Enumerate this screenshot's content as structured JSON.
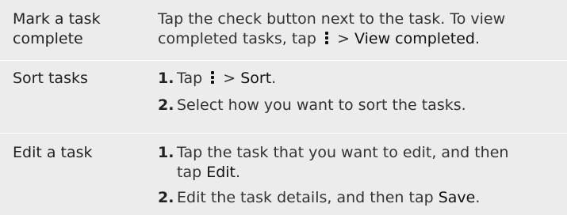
{
  "rows": [
    {
      "label": "Mark a task complete",
      "body_1": "Tap the check button next to the task. To view",
      "body_2a": "completed tasks, tap",
      "body_2b": " > ",
      "body_2c": "View completed",
      "body_2d": "."
    },
    {
      "label": "Sort tasks",
      "steps": [
        {
          "num": "1.",
          "a": "Tap",
          "b": " > ",
          "c": "Sort",
          "d": "."
        },
        {
          "num": "2.",
          "text": "Select how you want to sort the tasks."
        }
      ]
    },
    {
      "label": "Edit a task",
      "steps": [
        {
          "num": "1.",
          "line1": "Tap the task that you want to edit, and then",
          "line2a": "tap ",
          "line2b": "Edit",
          "line2c": "."
        },
        {
          "num": "2.",
          "a": "Edit the task details, and then tap ",
          "b": "Save",
          "c": "."
        }
      ]
    }
  ],
  "icons": {
    "overflow_menu": "more-vertical-icon"
  },
  "colors": {
    "row_background": "#ececec",
    "divider": "#ffffff"
  }
}
